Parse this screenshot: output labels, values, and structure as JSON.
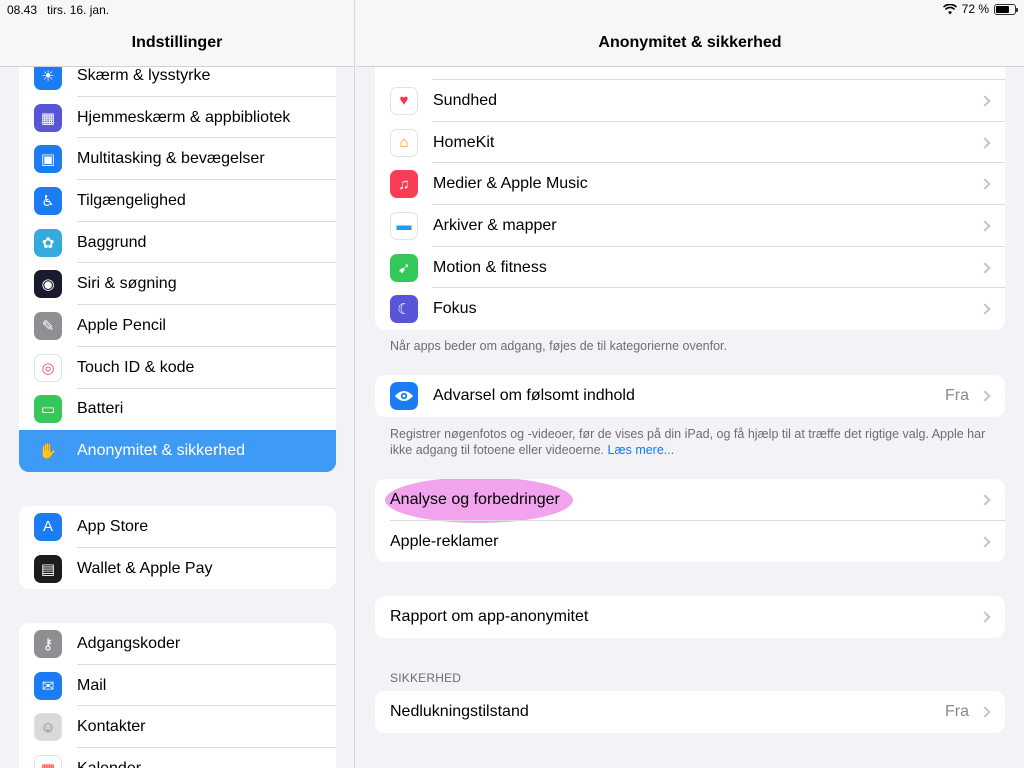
{
  "status": {
    "time": "08.43",
    "date": "tirs. 16. jan.",
    "battery": "72 %",
    "battery_level": 0.72
  },
  "sidebar": {
    "title": "Indstillinger",
    "group1": [
      {
        "label": "Skærm & lysstyrke",
        "icon": "sun-icon",
        "color": "#1c7cf4"
      },
      {
        "label": "Hjemmeskærm & appbibliotek",
        "icon": "grid-icon",
        "color": "#5856d6"
      },
      {
        "label": "Multitasking & bevægelser",
        "icon": "multitasking-icon",
        "color": "#1c7cf4"
      },
      {
        "label": "Tilgængelighed",
        "icon": "accessibility-icon",
        "color": "#1c7cf4"
      },
      {
        "label": "Baggrund",
        "icon": "flower-icon",
        "color": "#35aadc"
      },
      {
        "label": "Siri & søgning",
        "icon": "siri-icon",
        "color": "#1a1a2e"
      },
      {
        "label": "Apple Pencil",
        "icon": "pencil-icon",
        "color": "#8e8e93"
      },
      {
        "label": "Touch ID & kode",
        "icon": "fingerprint-icon",
        "color": "#ffffff"
      },
      {
        "label": "Batteri",
        "icon": "battery-icon",
        "color": "#34c759"
      },
      {
        "label": "Anonymitet & sikkerhed",
        "icon": "hand-icon",
        "color": "#1c7cf4",
        "selected": true
      }
    ],
    "group2": [
      {
        "label": "App Store",
        "icon": "appstore-icon",
        "color": "#1c7cf4"
      },
      {
        "label": "Wallet & Apple Pay",
        "icon": "wallet-icon",
        "color": "#1c1c1e"
      }
    ],
    "group3": [
      {
        "label": "Adgangskoder",
        "icon": "key-icon",
        "color": "#8e8e93"
      },
      {
        "label": "Mail",
        "icon": "mail-icon",
        "color": "#1c7cf4"
      },
      {
        "label": "Kontakter",
        "icon": "contacts-icon",
        "color": "#d9d9d9"
      },
      {
        "label": "Kalender",
        "icon": "calendar-icon",
        "color": "#ffffff"
      }
    ]
  },
  "detail": {
    "title": "Anonymitet & sikkerhed",
    "apps": [
      {
        "label": "Sundhed",
        "icon": "heart-icon",
        "color": "#ffffff"
      },
      {
        "label": "HomeKit",
        "icon": "home-icon",
        "color": "#ffffff"
      },
      {
        "label": "Medier & Apple Music",
        "icon": "music-icon",
        "color": "#fa3d56"
      },
      {
        "label": "Arkiver & mapper",
        "icon": "folder-icon",
        "color": "#ffffff"
      },
      {
        "label": "Motion & fitness",
        "icon": "running-icon",
        "color": "#34c759"
      },
      {
        "label": "Fokus",
        "icon": "moon-icon",
        "color": "#5856d6"
      }
    ],
    "apps_footer": "Når apps beder om adgang, føjes de til kategorierne ovenfor.",
    "sensitive": {
      "label": "Advarsel om følsomt indhold",
      "value": "Fra",
      "icon": "eye-icon",
      "color": "#1c7cf4"
    },
    "sensitive_footer": "Registrer nøgenfotos og -videoer, før de vises på din iPad, og få hjælp til at træffe det rigtige valg. Apple har ikke adgang til fotoene eller videoerne.",
    "sensitive_link": "Læs mere...",
    "analytics": [
      {
        "label": "Analyse og forbedringer"
      },
      {
        "label": "Apple-reklamer"
      }
    ],
    "report": {
      "label": "Rapport om app-anonymitet"
    },
    "security_header": "SIKKERHED",
    "lockdown": {
      "label": "Nedlukningstilstand",
      "value": "Fra"
    }
  }
}
